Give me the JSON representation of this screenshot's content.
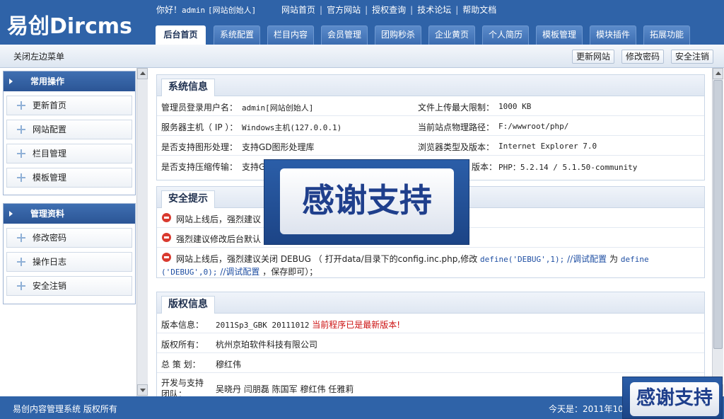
{
  "header": {
    "logo": "易创Dircms",
    "greeting_prefix": "你好！",
    "user": "admin",
    "role": "[网站创始人]",
    "links": [
      "网站首页",
      "官方网站",
      "授权查询",
      "技术论坛",
      "帮助文档"
    ],
    "tabs": [
      "后台首页",
      "系统配置",
      "栏目内容",
      "会员管理",
      "团购秒杀",
      "企业黄页",
      "个人简历",
      "模板管理",
      "模块插件",
      "拓展功能"
    ],
    "active_tab": "后台首页"
  },
  "subbar": {
    "close_menu": "关闭左边菜单",
    "buttons": [
      "更新网站",
      "修改密码",
      "安全注销"
    ]
  },
  "sidebar": {
    "groups": [
      {
        "title": "常用操作",
        "items": [
          "更新首页",
          "网站配置",
          "栏目管理",
          "模板管理"
        ]
      },
      {
        "title": "管理资料",
        "items": [
          "修改密码",
          "操作日志",
          "安全注销"
        ]
      }
    ]
  },
  "system_info": {
    "title": "系统信息",
    "rows": [
      {
        "l_label": "管理员登录用户名：",
        "l_value": "admin[网站创始人]",
        "r_label": "文件上传最大限制：",
        "r_value": "1000 KB"
      },
      {
        "l_label": "服务器主机（ IP ）：",
        "l_value": "Windows主机(127.0.0.1)",
        "r_label": "当前站点物理路径：",
        "r_value": "F:/wwwroot/php/"
      },
      {
        "l_label": "是否支持图形处理：",
        "l_value": "支持GD图形处理库",
        "r_label": "浏览器类型及版本：",
        "r_value": "Internet Explorer 7.0"
      },
      {
        "l_label": "是否支持压缩传输：",
        "l_value": "支持G",
        "r_label": "版本：",
        "r_value": "PHP：5.2.14  / 5.1.50-community"
      }
    ]
  },
  "security": {
    "title": "安全提示",
    "tip1": "网站上线后，强烈建议",
    "tip2": "强烈建议修改后台默认",
    "tip3_a": "网站上线后，强烈建议关闭 DEBUG （ 打开data/目录下的config.inc.php,修改",
    "tip3_code1": "define('DEBUG',1);",
    "tip3_comment1": "//调试配置",
    "tip3_for": "为",
    "tip3_code2": "define",
    "tip3_code3": "('DEBUG',0);",
    "tip3_comment2": "//调试配置",
    "tip3_end": "，保存即可）；"
  },
  "copyright": {
    "title": "版权信息",
    "version_label": "版本信息：",
    "version_value": "2011Sp3_GBK 20111012",
    "version_status": "当前程序已是最新版本!",
    "owner_label": "版权所有：",
    "owner_value": "杭州京珀软件科技有限公司",
    "planner_label": "总 策 划：",
    "planner_value": "穆红伟",
    "dev_label": "开发与支持团队：",
    "dev_value": "吴晓丹 闫朋磊 陈国军 穆红伟 任雅莉"
  },
  "footer": {
    "left": "易创内容管理系统 版权所有",
    "right": "今天是：2011年10月"
  },
  "watermark": {
    "text": "感谢支持"
  },
  "colors": {
    "header_bg": "#2f63a8",
    "status_red": "#cc1111"
  }
}
